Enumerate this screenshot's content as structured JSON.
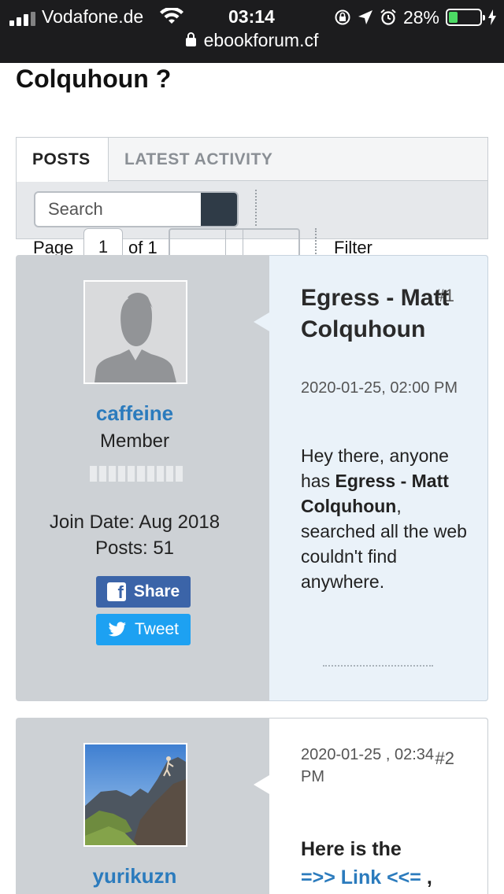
{
  "status_bar": {
    "carrier": "Vodafone.de",
    "time": "03:14",
    "battery_percent": "28%",
    "battery_level": 0.28,
    "url": "ebookforum.cf"
  },
  "page": {
    "title": "Colquhoun ?"
  },
  "tabs": [
    {
      "label": "POSTS",
      "active": true
    },
    {
      "label": "LATEST ACTIVITY",
      "active": false
    }
  ],
  "search": {
    "placeholder": "Search"
  },
  "pagination": {
    "page_label": "Page",
    "current_page": "1",
    "of_label": "of 1",
    "filter_label": "Filter"
  },
  "posts": [
    {
      "number": "#1",
      "author": "caffeine",
      "role": "Member",
      "join_date": "Join Date: Aug 2018",
      "posts_count": "Posts: 51",
      "share_label": "Share",
      "tweet_label": "Tweet",
      "title": "Egress - Matt Colquhoun",
      "date": "2020-01-25, 02:00 PM",
      "body_1": "Hey there, anyone has",
      "body_bold": "Egress - Matt Colquhoun",
      "body_2": ", searched all the web couldn't find anywhere."
    },
    {
      "number": "#2",
      "author": "yurikuzn",
      "date": "2020-01-25 , 02:34 PM",
      "body_1": "Here is the",
      "link_label": "=>> Link <<=",
      "body_2": ","
    }
  ],
  "colors": {
    "link": "#2b7bbd",
    "post_bg": "#cdd1d5",
    "highlight_bg": "#eaf2f9",
    "facebook": "#3b64a8",
    "twitter": "#1da1f2",
    "battery": "#4cd964"
  }
}
